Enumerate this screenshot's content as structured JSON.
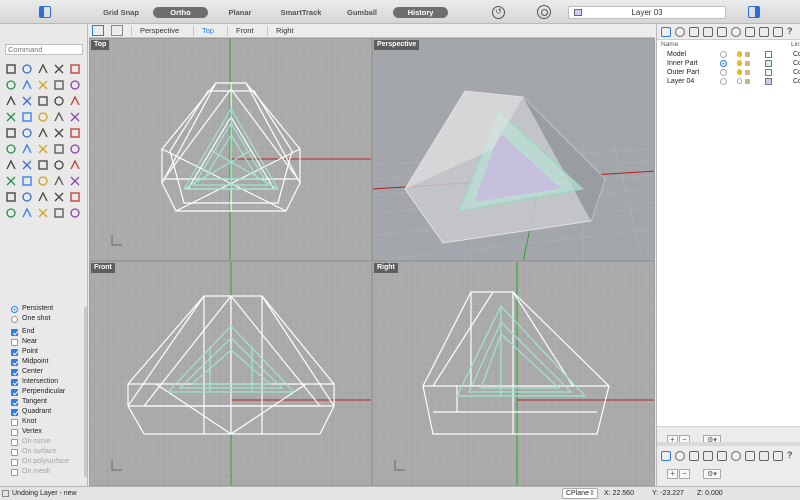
{
  "toolbar": {
    "buttons": [
      {
        "label": "Grid Snap",
        "active": false
      },
      {
        "label": "Ortho",
        "active": true
      },
      {
        "label": "Planar",
        "active": false
      },
      {
        "label": "SmartTrack",
        "active": false
      },
      {
        "label": "Gumball",
        "active": false
      },
      {
        "label": "History",
        "active": true
      }
    ],
    "current_layer": "Layer 03",
    "current_layer_color": "#d8c8f2"
  },
  "command": {
    "placeholder": "Command"
  },
  "viewport_tabs": [
    "Perspective",
    "Top",
    "Front",
    "Right"
  ],
  "active_viewport_tab": "Top",
  "viewports": {
    "top": "Top",
    "perspective": "Perspective",
    "front": "Front",
    "right": "Right"
  },
  "osnap": {
    "modes": [
      {
        "label": "Persistent",
        "selected": true
      },
      {
        "label": "One shot",
        "selected": false
      }
    ],
    "snaps": [
      {
        "label": "End",
        "checked": true,
        "enabled": true
      },
      {
        "label": "Near",
        "checked": false,
        "enabled": true
      },
      {
        "label": "Point",
        "checked": true,
        "enabled": true
      },
      {
        "label": "Midpoint",
        "checked": true,
        "enabled": true
      },
      {
        "label": "Center",
        "checked": true,
        "enabled": true
      },
      {
        "label": "Intersection",
        "checked": true,
        "enabled": true
      },
      {
        "label": "Perpendicular",
        "checked": true,
        "enabled": true
      },
      {
        "label": "Tangent",
        "checked": true,
        "enabled": true
      },
      {
        "label": "Quadrant",
        "checked": true,
        "enabled": true
      },
      {
        "label": "Knot",
        "checked": false,
        "enabled": true
      },
      {
        "label": "Vertex",
        "checked": false,
        "enabled": true
      },
      {
        "label": "On curve",
        "checked": false,
        "enabled": false
      },
      {
        "label": "On surface",
        "checked": false,
        "enabled": false
      },
      {
        "label": "On polysurface",
        "checked": false,
        "enabled": false
      },
      {
        "label": "On mesh",
        "checked": false,
        "enabled": false
      }
    ]
  },
  "layers": {
    "headers": {
      "name": "Name",
      "material": "Lin"
    },
    "rows": [
      {
        "name": "Model",
        "current": false,
        "on": true,
        "color": "#ffffff",
        "material": "Co"
      },
      {
        "name": "Inner Part",
        "current": true,
        "on": true,
        "color": "#c8f0e4",
        "material": "Co"
      },
      {
        "name": "Outer Part",
        "current": false,
        "on": true,
        "color": "#f4f4f4",
        "material": "Co"
      },
      {
        "name": "Layer 04",
        "current": false,
        "on": false,
        "color": "#d8c8f2",
        "material": "Co"
      }
    ]
  },
  "status": {
    "message": "Undoing Layer - new",
    "cplane": "CPlane",
    "x": "X: 22.560",
    "y": "Y: -23.227",
    "z": "Z: 0.000"
  },
  "colors": {
    "viewport_bg": "#a9a9a9",
    "perspective_bg": "#a3a6ab",
    "wire": "#ffffff",
    "inner_wire": "#9ee6d2",
    "axis_x": "#b22222",
    "axis_y": "#2ea02e"
  }
}
